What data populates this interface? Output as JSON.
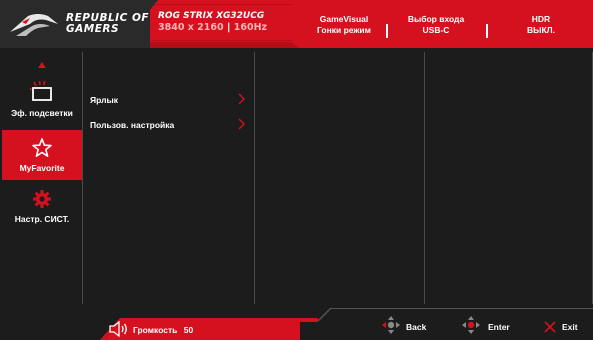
{
  "header": {
    "brand_line1": "REPUBLIC OF",
    "brand_line2": "GAMERS",
    "model": "ROG STRIX XG32UCG",
    "resolution": "3840 x 2160",
    "refresh": "160Hz",
    "status": [
      {
        "title": "GameVisual",
        "value": "Гонки режим"
      },
      {
        "title": "Выбор входа",
        "value": "USB-C"
      },
      {
        "title": "HDR",
        "value": "ВЫКЛ."
      }
    ]
  },
  "sidebar": {
    "items": [
      {
        "label": "Эф. подсветки",
        "icon": "backlight-effect-icon",
        "active": false
      },
      {
        "label": "MyFavorite",
        "icon": "star-icon",
        "active": true
      },
      {
        "label": "Настр. СИСТ.",
        "icon": "gear-icon",
        "active": false
      }
    ]
  },
  "menu": {
    "items": [
      {
        "label": "Ярлык"
      },
      {
        "label": "Пользов. настройка"
      }
    ]
  },
  "footer": {
    "volume_label": "Громкость",
    "volume_value": "50",
    "back": "Back",
    "enter": "Enter",
    "exit": "Exit"
  },
  "colors": {
    "accent": "#d6111f",
    "background": "#1c1c1c",
    "text": "#ffffff"
  }
}
